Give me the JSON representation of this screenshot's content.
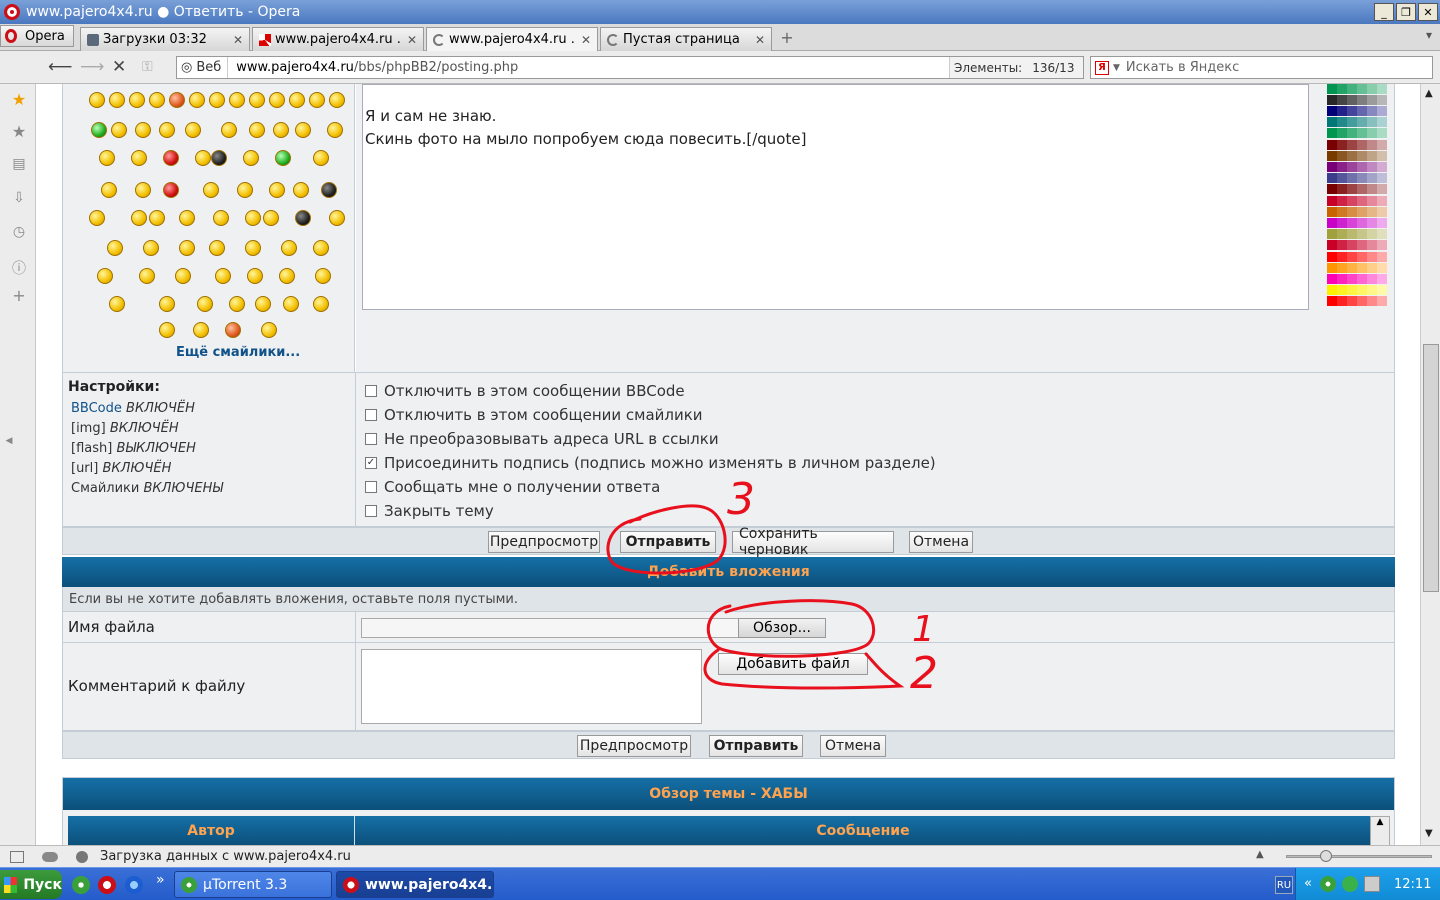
{
  "window": {
    "title": "www.pajero4x4.ru ● Ответить - Opera",
    "controls": [
      "_",
      "❐",
      "✕"
    ]
  },
  "tabs": {
    "menu_label": "Opera",
    "items": [
      {
        "label": "Загрузки 03:32",
        "icon": "downloads-icon"
      },
      {
        "label": "www.pajero4x4.ru ...",
        "icon": "mitsubishi-icon"
      },
      {
        "label": "www.pajero4x4.ru ...",
        "icon": "loading-icon",
        "active": true
      },
      {
        "label": "Пустая страница",
        "icon": "loading-icon"
      }
    ],
    "close": "✕",
    "new_tab": "+"
  },
  "addressbar": {
    "web_label": "Веб",
    "url_host": "www.pajero4x4.ru",
    "url_path": "/bbs/phpBB2/posting.php",
    "elements_label": "Элементы:",
    "elements_value": "136/13",
    "search_placeholder": "Искать в Яндекс",
    "search_engine": "Я"
  },
  "editor": {
    "line1": "Я и сам не знаю.",
    "line2": "Скинь фото на мыло попробуем сюда повесить.[/quote]",
    "more_smilies": "Ещё смайлики..."
  },
  "settings": {
    "header": "Настройки:",
    "bbcode_label": "BBCode",
    "bbcode_state": "ВКЛЮЧЁН",
    "img_label": "[img]",
    "img_state": "ВКЛЮЧЁН",
    "flash_label": "[flash]",
    "flash_state": "ВЫКЛЮЧЕН",
    "url_label": "[url]",
    "url_state": "ВКЛЮЧЁН",
    "smilies_label": "Смайлики",
    "smilies_state": "ВКЛЮЧЕНЫ",
    "options": [
      {
        "label": "Отключить в этом сообщении BBCode",
        "checked": false
      },
      {
        "label": "Отключить в этом сообщении смайлики",
        "checked": false
      },
      {
        "label": "Не преобразовывать адреса URL в ссылки",
        "checked": false
      },
      {
        "label": "Присоединить подпись (подпись можно изменять в личном разделе)",
        "checked": true
      },
      {
        "label": "Сообщать мне о получении ответа",
        "checked": false
      },
      {
        "label": "Закрыть тему",
        "checked": false
      }
    ],
    "check_mark": "✓"
  },
  "buttons": {
    "preview": "Предпросмотр",
    "submit": "Отправить",
    "save_draft": "Сохранить черновик",
    "cancel": "Отмена"
  },
  "attachments": {
    "header": "Добавить вложения",
    "hint": "Если вы не хотите добавлять вложения, оставьте поля пустыми.",
    "filename_label": "Имя файла",
    "browse": "Обзор...",
    "comment_label": "Комментарий к файлу",
    "add_file": "Добавить файл"
  },
  "review": {
    "header": "Обзор темы - ХАБЫ",
    "col_author": "Автор",
    "col_message": "Сообщение"
  },
  "annotations": {
    "n1": "1",
    "n2": "2",
    "n3": "3",
    "color": "#e8101c"
  },
  "statusbar": {
    "text": "Загрузка данных с www.pajero4x4.ru"
  },
  "taskbar": {
    "start": "Пуск",
    "more": "»",
    "apps": [
      {
        "label": "µTorrent 3.3",
        "icon": "utorrent-icon"
      },
      {
        "label": "www.pajero4x4....",
        "icon": "opera-icon"
      }
    ],
    "lang": "RU",
    "tray_more": "«",
    "clock": "12:11"
  },
  "colors": {
    "forum_blue": "#0c4f7a",
    "header_text": "#ffa34f",
    "link": "#105289",
    "taskbar": "#245ccb"
  }
}
